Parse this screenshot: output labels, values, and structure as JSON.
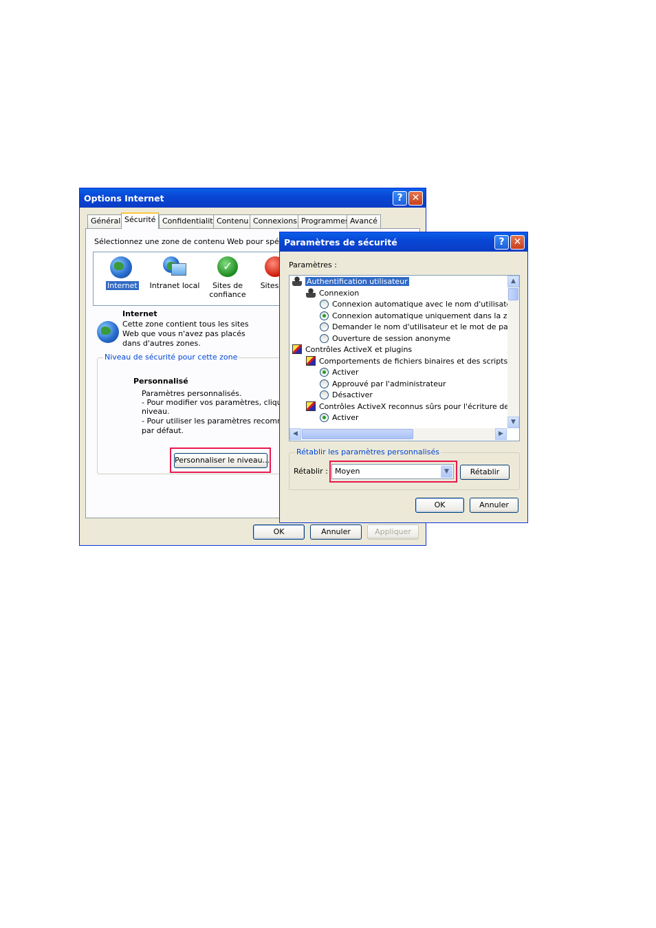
{
  "options_window": {
    "title": "Options Internet",
    "tabs": [
      "Général",
      "Sécurité",
      "Confidentialité",
      "Contenu",
      "Connexions",
      "Programmes",
      "Avancé"
    ],
    "zone_prompt": "Sélectionnez une zone de contenu Web pour spécifier",
    "zones": [
      {
        "label": "Internet",
        "icon": "globe-icon"
      },
      {
        "label": "Intranet local",
        "icon": "monitor-globe-icon"
      },
      {
        "label": "Sites de confiance",
        "icon": "green-check-icon"
      },
      {
        "label": "Sites se",
        "icon": "red-stop-icon"
      }
    ],
    "zone_title": "Internet",
    "zone_desc": [
      "Cette zone contient tous les sites",
      "Web que vous n'avez pas placés",
      "dans d'autres zones."
    ],
    "level_group": "Niveau de sécurité pour cette zone",
    "level_title": "Personnalisé",
    "level_desc": [
      "Paramètres personnalisés.",
      "- Pour modifier vos paramètres, cliquez su",
      "niveau.",
      "- Pour utiliser les paramètres recommandé",
      "par défaut."
    ],
    "customize_button": "Personnaliser le niveau...",
    "ok": "OK",
    "cancel": "Annuler",
    "apply": "Appliquer"
  },
  "security_window": {
    "title": "Paramètres de sécurité",
    "settings_label": "Paramètres :",
    "tree": [
      {
        "text": "Authentification utilisateur",
        "indent": 0,
        "type": "user-icon",
        "selected": true
      },
      {
        "text": "Connexion",
        "indent": 1,
        "type": "user-icon"
      },
      {
        "text": "Connexion automatique avec le nom d'utilisateur et",
        "indent": 2,
        "type": "radio",
        "checked": false
      },
      {
        "text": "Connexion automatique uniquement dans la zone ir",
        "indent": 2,
        "type": "radio",
        "checked": true
      },
      {
        "text": "Demander le nom d'utilisateur et le mot de passe",
        "indent": 2,
        "type": "radio",
        "checked": false
      },
      {
        "text": "Ouverture de session anonyme",
        "indent": 2,
        "type": "radio",
        "checked": false
      },
      {
        "text": "Contrôles ActiveX et plugins",
        "indent": 0,
        "type": "cert-icon"
      },
      {
        "text": "Comportements de fichiers binaires et des scripts",
        "indent": 1,
        "type": "cert-icon"
      },
      {
        "text": "Activer",
        "indent": 2,
        "type": "radio",
        "checked": true
      },
      {
        "text": "Approuvé par l'administrateur",
        "indent": 2,
        "type": "radio",
        "checked": false
      },
      {
        "text": "Désactiver",
        "indent": 2,
        "type": "radio",
        "checked": false
      },
      {
        "text": "Contrôles ActiveX reconnus sûrs pour l'écriture de scrip",
        "indent": 1,
        "type": "cert-icon"
      },
      {
        "text": "Activer",
        "indent": 2,
        "type": "radio",
        "checked": true
      }
    ],
    "reset_group": "Rétablir les paramètres personnalisés",
    "reset_label": "Rétablir :",
    "reset_value": "Moyen",
    "reset_button": "Rétablir",
    "ok": "OK",
    "cancel": "Annuler"
  },
  "colors": {
    "highlight": "#e8174e",
    "xp_blue": "#0a5fe8",
    "selection": "#316ac5"
  }
}
